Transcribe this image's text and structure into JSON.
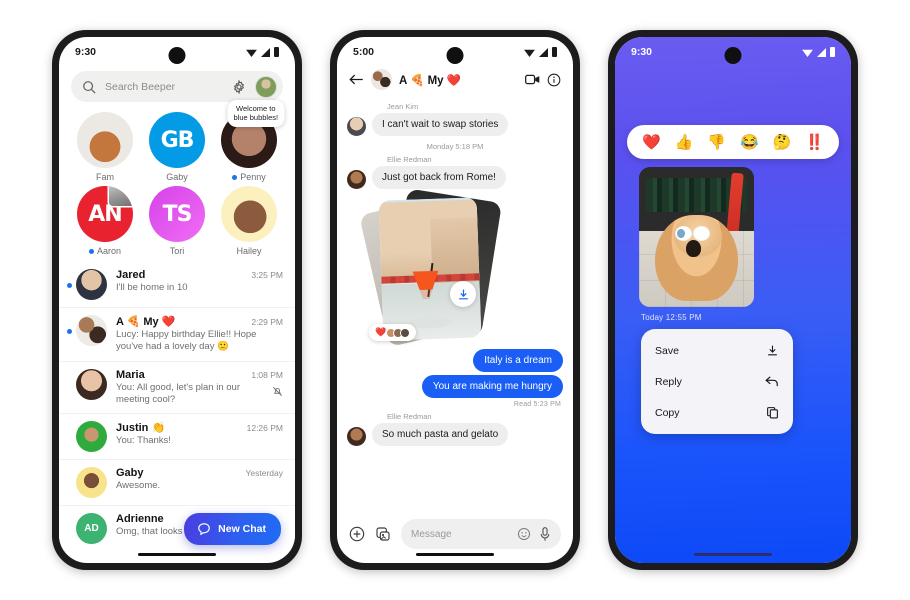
{
  "phone1": {
    "status": {
      "time": "9:30",
      "icons": [
        "wifi-icon",
        "signal-icon",
        "battery-icon"
      ]
    },
    "search": {
      "placeholder": "Search Beeper",
      "icon": "search-icon",
      "settings_icon": "gear-icon",
      "avatar": "profile-avatar"
    },
    "stories": [
      {
        "label": "Fam",
        "unread": false,
        "badge": ""
      },
      {
        "label": "Gaby",
        "unread": false,
        "badge": "",
        "monogram": "GB"
      },
      {
        "label": "Penny",
        "unread": true,
        "badge": "Welcome to\nblue bubbles!"
      },
      {
        "label": "Aaron",
        "unread": true,
        "badge": "",
        "monogram": "AN"
      },
      {
        "label": "Tori",
        "unread": false,
        "badge": "",
        "monogram": "TS"
      },
      {
        "label": "Hailey",
        "unread": false,
        "badge": ""
      }
    ],
    "chats": [
      {
        "name": "Jared",
        "preview": "I'll be home in 10",
        "time": "3:25 PM",
        "unread": true,
        "muted": false
      },
      {
        "name": "A 🍕 My ❤️",
        "preview": "Lucy: Happy birthday Ellie!! Hope you've had a lovely day  🙂",
        "time": "2:29 PM",
        "unread": true,
        "muted": false
      },
      {
        "name": "Maria",
        "preview": "You: All good, let's plan in our meeting cool?",
        "time": "1:08 PM",
        "unread": false,
        "muted": true
      },
      {
        "name": "Justin 👏",
        "preview": "You: Thanks!",
        "time": "12:26 PM",
        "unread": false,
        "muted": false
      },
      {
        "name": "Gaby",
        "preview": "Awesome.",
        "time": "Yesterday",
        "unread": false,
        "muted": false
      },
      {
        "name": "Adrienne",
        "preview": "Omg, that looks so nice!",
        "time": "",
        "unread": false,
        "muted": false,
        "initials": "AD"
      }
    ],
    "fab": {
      "label": "New Chat",
      "icon": "chat-bubble-icon"
    }
  },
  "phone2": {
    "status": {
      "time": "5:00"
    },
    "header": {
      "title": "A 🍕 My ❤️",
      "back_icon": "back-arrow-icon",
      "video_icon": "video-call-icon",
      "info_icon": "info-icon"
    },
    "messages": [
      {
        "type": "incoming",
        "sender": "Jean Kim",
        "text": "I can't wait to swap stories"
      },
      {
        "type": "daystamp",
        "text": "Monday 5:18 PM"
      },
      {
        "type": "incoming",
        "sender": "Ellie Redman",
        "text": "Just got back from Rome!"
      },
      {
        "type": "photo",
        "reaction": "❤️",
        "reactors": 3,
        "download_icon": "download-icon"
      },
      {
        "type": "outgoing",
        "text": "Italy is a dream"
      },
      {
        "type": "outgoing",
        "text": "You are making me hungry"
      },
      {
        "type": "readstamp",
        "text": "Read  5:23 PM"
      },
      {
        "type": "incoming",
        "sender": "Ellie Redman",
        "text": "So much pasta and gelato"
      }
    ],
    "composer": {
      "placeholder": "Message",
      "plus_icon": "plus-icon",
      "gallery_icon": "gallery-icon",
      "emoji_icon": "emoji-icon",
      "mic_icon": "microphone-icon"
    }
  },
  "phone3": {
    "status": {
      "time": "9:30"
    },
    "reactions": [
      "❤️",
      "👍",
      "👎",
      "😂",
      "🤔",
      "‼️"
    ],
    "photo": {
      "timestamp": "Today  12:55 PM",
      "alt": "dog-with-sunglasses-photo"
    },
    "menu": [
      {
        "label": "Save",
        "icon": "download-icon"
      },
      {
        "label": "Reply",
        "icon": "reply-arrow-icon"
      },
      {
        "label": "Copy",
        "icon": "copy-icon"
      }
    ],
    "colors": {
      "bg_top": "#6a5cf0",
      "bg_bottom": "#0d49f7"
    }
  },
  "theme": {
    "accent_blue": "#1a5ef5",
    "unread_dot": "#1a73e8",
    "bubble_in": "#eeeeee",
    "surface": "#ffffff"
  }
}
